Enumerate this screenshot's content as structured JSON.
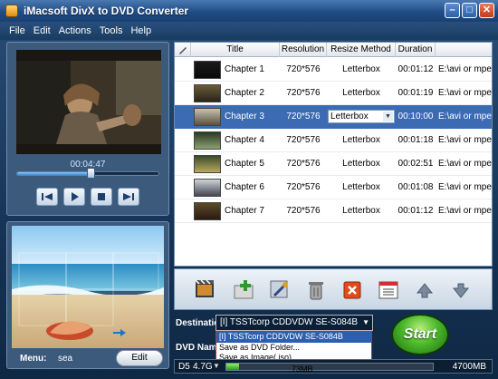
{
  "app": {
    "title": "iMacsoft DivX to DVD Converter"
  },
  "menu": [
    "File",
    "Edit",
    "Actions",
    "Tools",
    "Help"
  ],
  "player": {
    "time": "00:04:47",
    "progress": 0.52
  },
  "preview": {
    "menu_label": "Menu:",
    "menu_value": "sea",
    "edit_label": "Edit"
  },
  "table": {
    "headers": [
      "Title",
      "Resolution",
      "Resize Method",
      "Duration"
    ],
    "rows": [
      {
        "title": "Chapter 1",
        "resolution": "720*576",
        "resize": "Letterbox",
        "duration": "00:01:12",
        "path": "E:\\avi or mpeg",
        "selected": false
      },
      {
        "title": "Chapter 2",
        "resolution": "720*576",
        "resize": "Letterbox",
        "duration": "00:01:19",
        "path": "E:\\avi or mpeg",
        "selected": false
      },
      {
        "title": "Chapter 3",
        "resolution": "720*576",
        "resize": "Letterbox",
        "duration": "00:10:00",
        "path": "E:\\avi or mpeg",
        "selected": true
      },
      {
        "title": "Chapter 4",
        "resolution": "720*576",
        "resize": "Letterbox",
        "duration": "00:01:18",
        "path": "E:\\avi or mpeg",
        "selected": false
      },
      {
        "title": "Chapter 5",
        "resolution": "720*576",
        "resize": "Letterbox",
        "duration": "00:02:51",
        "path": "E:\\avi or mpeg",
        "selected": false
      },
      {
        "title": "Chapter 6",
        "resolution": "720*576",
        "resize": "Letterbox",
        "duration": "00:01:08",
        "path": "E:\\avi or mpeg",
        "selected": false
      },
      {
        "title": "Chapter 7",
        "resolution": "720*576",
        "resize": "Letterbox",
        "duration": "00:01:12",
        "path": "E:\\avi or mpeg",
        "selected": false
      }
    ]
  },
  "destination": {
    "label": "Destination:",
    "selected": "[I] TSSTcorp CDDVDW SE-S084B",
    "options": [
      "[I] TSSTcorp CDDVDW SE-S084B",
      "Save as DVD Folder...",
      "Save as Image(.iso)..."
    ]
  },
  "dvd_name_label": "DVD Name:",
  "start_label": "Start",
  "status": {
    "disc_type": "D5",
    "disc_size": "4.7G",
    "used": "73MB",
    "total": "4700MB",
    "fill_fraction": 0.06
  }
}
